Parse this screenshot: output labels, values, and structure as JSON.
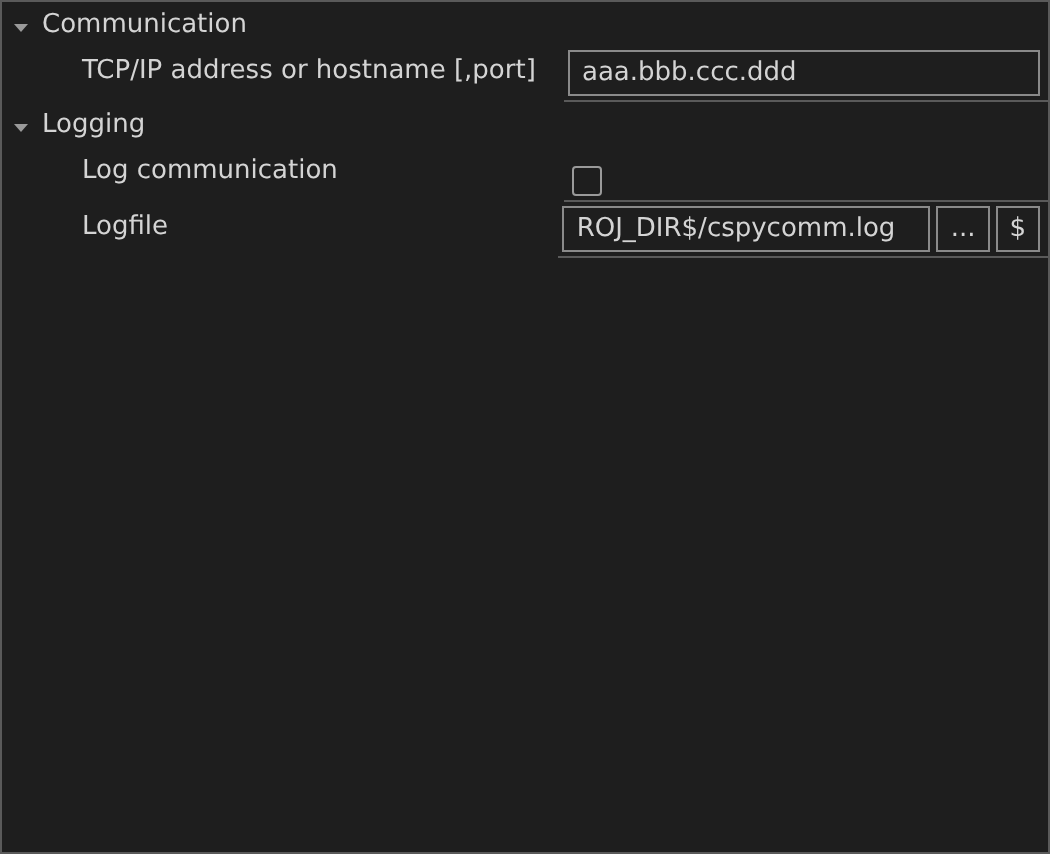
{
  "groups": [
    {
      "title": "Communication",
      "expanded": true,
      "properties": [
        {
          "kind": "text",
          "label": "TCP/IP address or hostname [,port]",
          "value": "aaa.bbb.ccc.ddd"
        }
      ]
    },
    {
      "title": "Logging",
      "expanded": true,
      "properties": [
        {
          "kind": "checkbox",
          "label": "Log communication",
          "checked": false
        },
        {
          "kind": "file",
          "label": "Logfile",
          "value": "ROJ_DIR$/cspycomm.log",
          "buttons": [
            "...",
            "$"
          ]
        }
      ]
    }
  ]
}
